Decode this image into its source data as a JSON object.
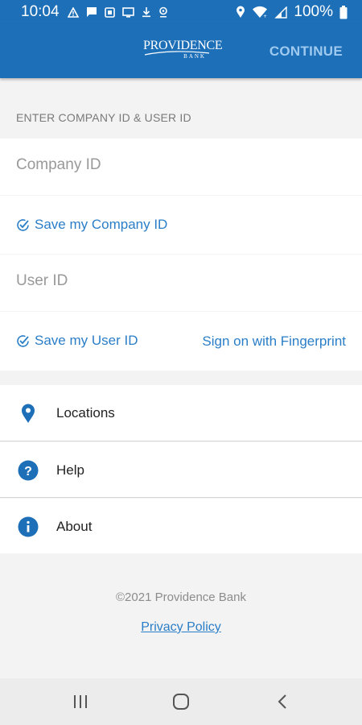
{
  "status_bar": {
    "time": "10:04",
    "battery": "100%",
    "left_icons": [
      "warning-icon",
      "chat-icon",
      "photo-icon",
      "cast-icon",
      "download-icon",
      "location-pin-icon"
    ],
    "right_icons": [
      "location-icon",
      "wifi-icon",
      "signal-icon",
      "battery-icon"
    ]
  },
  "app_bar": {
    "logo_line1": "PROVIDENCE",
    "logo_line2": "BANK",
    "continue_label": "CONTINUE"
  },
  "login": {
    "section_label": "ENTER COMPANY ID & USER ID",
    "company_id": {
      "placeholder": "Company ID",
      "value": ""
    },
    "save_company_label": "Save my Company ID",
    "user_id": {
      "placeholder": "User ID",
      "value": ""
    },
    "save_user_label": "Save my User ID",
    "fingerprint_label": "Sign on with Fingerprint"
  },
  "menu": {
    "items": [
      {
        "label": "Locations",
        "icon": "location-pin-icon"
      },
      {
        "label": "Help",
        "icon": "help-icon"
      },
      {
        "label": "About",
        "icon": "info-icon"
      }
    ]
  },
  "footer": {
    "copyright": "©2021 Providence Bank",
    "privacy_label": "Privacy Policy"
  },
  "colors": {
    "brand_blue": "#1d6fb8",
    "link_blue": "#2a7ec7",
    "continue_text": "#9fcaf0"
  }
}
